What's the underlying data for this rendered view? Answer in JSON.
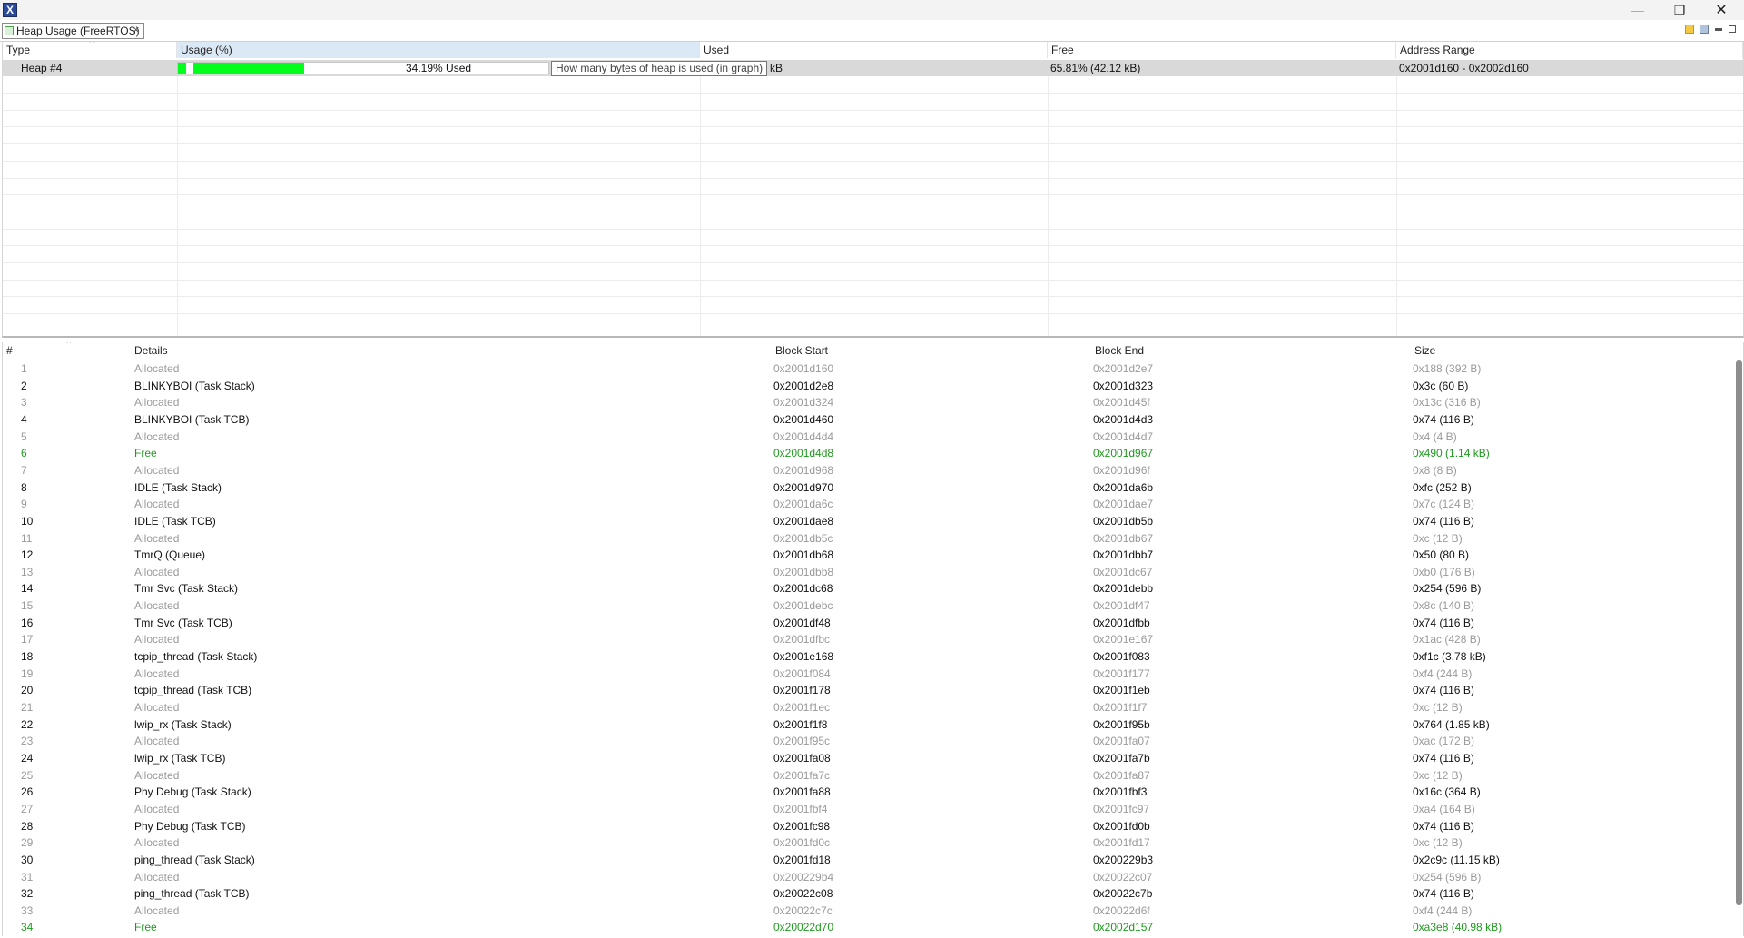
{
  "window": {
    "app_icon_glyph": "X",
    "minimize_glyph": "—",
    "restore_glyph": "❐",
    "close_glyph": "✕"
  },
  "tab": {
    "label": "Heap Usage (FreeRTOS)",
    "close_glyph": "×"
  },
  "heap_table": {
    "columns": [
      "Type",
      "Usage (%)",
      "Used",
      "Free",
      "Address Range"
    ],
    "row": {
      "type": "Heap #4",
      "usage_fraction": 0.3419,
      "usage_label": "34.19% Used",
      "used_tail": "kB",
      "free": "65.81% (42.12 kB)",
      "address_range": "0x2001d160 - 0x2002d160"
    },
    "tooltip": "How many bytes of heap is used (in graph)"
  },
  "blocks_table": {
    "columns": [
      "#",
      "Details",
      "Block Start",
      "Block End",
      "Size"
    ],
    "rows": [
      {
        "n": "1",
        "details": "Allocated",
        "start": "0x2001d160",
        "end": "0x2001d2e7",
        "size": "0x188 (392 B)",
        "kind": "dim"
      },
      {
        "n": "2",
        "details": "BLINKYBOI (Task Stack)",
        "start": "0x2001d2e8",
        "end": "0x2001d323",
        "size": "0x3c (60 B)",
        "kind": "norm"
      },
      {
        "n": "3",
        "details": "Allocated",
        "start": "0x2001d324",
        "end": "0x2001d45f",
        "size": "0x13c (316 B)",
        "kind": "dim"
      },
      {
        "n": "4",
        "details": "BLINKYBOI (Task TCB)",
        "start": "0x2001d460",
        "end": "0x2001d4d3",
        "size": "0x74 (116 B)",
        "kind": "norm"
      },
      {
        "n": "5",
        "details": "Allocated",
        "start": "0x2001d4d4",
        "end": "0x2001d4d7",
        "size": "0x4 (4 B)",
        "kind": "dim"
      },
      {
        "n": "6",
        "details": "Free",
        "start": "0x2001d4d8",
        "end": "0x2001d967",
        "size": "0x490 (1.14 kB)",
        "kind": "free"
      },
      {
        "n": "7",
        "details": "Allocated",
        "start": "0x2001d968",
        "end": "0x2001d96f",
        "size": "0x8 (8 B)",
        "kind": "dim"
      },
      {
        "n": "8",
        "details": "IDLE (Task Stack)",
        "start": "0x2001d970",
        "end": "0x2001da6b",
        "size": "0xfc (252 B)",
        "kind": "norm"
      },
      {
        "n": "9",
        "details": "Allocated",
        "start": "0x2001da6c",
        "end": "0x2001dae7",
        "size": "0x7c (124 B)",
        "kind": "dim"
      },
      {
        "n": "10",
        "details": "IDLE (Task TCB)",
        "start": "0x2001dae8",
        "end": "0x2001db5b",
        "size": "0x74 (116 B)",
        "kind": "norm"
      },
      {
        "n": "11",
        "details": "Allocated",
        "start": "0x2001db5c",
        "end": "0x2001db67",
        "size": "0xc (12 B)",
        "kind": "dim"
      },
      {
        "n": "12",
        "details": "TmrQ (Queue)",
        "start": "0x2001db68",
        "end": "0x2001dbb7",
        "size": "0x50 (80 B)",
        "kind": "norm"
      },
      {
        "n": "13",
        "details": "Allocated",
        "start": "0x2001dbb8",
        "end": "0x2001dc67",
        "size": "0xb0 (176 B)",
        "kind": "dim"
      },
      {
        "n": "14",
        "details": "Tmr Svc (Task Stack)",
        "start": "0x2001dc68",
        "end": "0x2001debb",
        "size": "0x254 (596 B)",
        "kind": "norm"
      },
      {
        "n": "15",
        "details": "Allocated",
        "start": "0x2001debc",
        "end": "0x2001df47",
        "size": "0x8c (140 B)",
        "kind": "dim"
      },
      {
        "n": "16",
        "details": "Tmr Svc (Task TCB)",
        "start": "0x2001df48",
        "end": "0x2001dfbb",
        "size": "0x74 (116 B)",
        "kind": "norm"
      },
      {
        "n": "17",
        "details": "Allocated",
        "start": "0x2001dfbc",
        "end": "0x2001e167",
        "size": "0x1ac (428 B)",
        "kind": "dim"
      },
      {
        "n": "18",
        "details": "tcpip_thread (Task Stack)",
        "start": "0x2001e168",
        "end": "0x2001f083",
        "size": "0xf1c (3.78 kB)",
        "kind": "norm"
      },
      {
        "n": "19",
        "details": "Allocated",
        "start": "0x2001f084",
        "end": "0x2001f177",
        "size": "0xf4 (244 B)",
        "kind": "dim"
      },
      {
        "n": "20",
        "details": "tcpip_thread (Task TCB)",
        "start": "0x2001f178",
        "end": "0x2001f1eb",
        "size": "0x74 (116 B)",
        "kind": "norm"
      },
      {
        "n": "21",
        "details": "Allocated",
        "start": "0x2001f1ec",
        "end": "0x2001f1f7",
        "size": "0xc (12 B)",
        "kind": "dim"
      },
      {
        "n": "22",
        "details": "lwip_rx (Task Stack)",
        "start": "0x2001f1f8",
        "end": "0x2001f95b",
        "size": "0x764 (1.85 kB)",
        "kind": "norm"
      },
      {
        "n": "23",
        "details": "Allocated",
        "start": "0x2001f95c",
        "end": "0x2001fa07",
        "size": "0xac (172 B)",
        "kind": "dim"
      },
      {
        "n": "24",
        "details": "lwip_rx (Task TCB)",
        "start": "0x2001fa08",
        "end": "0x2001fa7b",
        "size": "0x74 (116 B)",
        "kind": "norm"
      },
      {
        "n": "25",
        "details": "Allocated",
        "start": "0x2001fa7c",
        "end": "0x2001fa87",
        "size": "0xc (12 B)",
        "kind": "dim"
      },
      {
        "n": "26",
        "details": "Phy Debug (Task Stack)",
        "start": "0x2001fa88",
        "end": "0x2001fbf3",
        "size": "0x16c (364 B)",
        "kind": "norm"
      },
      {
        "n": "27",
        "details": "Allocated",
        "start": "0x2001fbf4",
        "end": "0x2001fc97",
        "size": "0xa4 (164 B)",
        "kind": "dim"
      },
      {
        "n": "28",
        "details": "Phy Debug (Task TCB)",
        "start": "0x2001fc98",
        "end": "0x2001fd0b",
        "size": "0x74 (116 B)",
        "kind": "norm"
      },
      {
        "n": "29",
        "details": "Allocated",
        "start": "0x2001fd0c",
        "end": "0x2001fd17",
        "size": "0xc (12 B)",
        "kind": "dim"
      },
      {
        "n": "30",
        "details": "ping_thread (Task Stack)",
        "start": "0x2001fd18",
        "end": "0x200229b3",
        "size": "0x2c9c (11.15 kB)",
        "kind": "norm"
      },
      {
        "n": "31",
        "details": "Allocated",
        "start": "0x200229b4",
        "end": "0x20022c07",
        "size": "0x254 (596 B)",
        "kind": "dim"
      },
      {
        "n": "32",
        "details": "ping_thread (Task TCB)",
        "start": "0x20022c08",
        "end": "0x20022c7b",
        "size": "0x74 (116 B)",
        "kind": "norm"
      },
      {
        "n": "33",
        "details": "Allocated",
        "start": "0x20022c7c",
        "end": "0x20022d6f",
        "size": "0xf4 (244 B)",
        "kind": "dim"
      },
      {
        "n": "34",
        "details": "Free",
        "start": "0x20022d70",
        "end": "0x2002d157",
        "size": "0xa3e8 (40.98 kB)",
        "kind": "free"
      }
    ]
  },
  "colors": {
    "usage_bar": "#00ff1a",
    "free_text": "#1f9a1f",
    "dim_text": "#9a9a9a",
    "selected_row": "#d9d9d9"
  }
}
